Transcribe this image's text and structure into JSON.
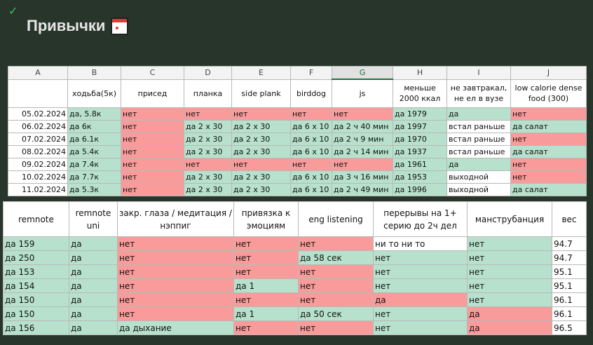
{
  "header": {
    "title": "Привычки",
    "icon": "calendar-icon",
    "status_icon": "check-icon"
  },
  "colors": {
    "g": "#b7e1cd",
    "r": "#f99b9b",
    "w": "#ffffff"
  },
  "sheet1": {
    "column_letters": [
      "A",
      "B",
      "C",
      "D",
      "E",
      "F",
      "G",
      "H",
      "I",
      "J"
    ],
    "selected_column": "G",
    "headers": [
      "",
      "ходьба(5к)",
      "присед",
      "планка",
      "side plank",
      "birddog",
      "js",
      "меньше 2000 ккал",
      "не завтракал, не ел в вузе",
      "low calorie dense food (300)"
    ],
    "rows": [
      {
        "date": "05.02.2024",
        "cells": [
          "да, 5.8к",
          "нет",
          "нет",
          "нет",
          "нет",
          "нет",
          "да 1979",
          "да",
          "нет"
        ],
        "colors": [
          "g",
          "r",
          "r",
          "r",
          "r",
          "r",
          "g",
          "g",
          "r"
        ]
      },
      {
        "date": "06.02.2024",
        "cells": [
          "да 6к",
          "нет",
          "да 2 x 30",
          "да 2 x 30",
          "да 6 x 10",
          "да 2 ч 40 мин",
          "да 1997",
          "встал раньше",
          "да салат"
        ],
        "colors": [
          "g",
          "r",
          "g",
          "g",
          "g",
          "g",
          "g",
          "w",
          "g"
        ]
      },
      {
        "date": "07.02.2024",
        "cells": [
          "да 6.1к",
          "нет",
          "да 2 x 30",
          "да 2 x 30",
          "да 6 x 10",
          "да 2 ч 9 мин",
          "да 1970",
          "встал раньше",
          "нет"
        ],
        "colors": [
          "g",
          "r",
          "g",
          "g",
          "g",
          "g",
          "g",
          "w",
          "r"
        ]
      },
      {
        "date": "08.02.2024",
        "cells": [
          "да 5.4к",
          "нет",
          "да 2 x 30",
          "да 2 x 30",
          "да 6 x 10",
          "да 2 ч 14 мин",
          "да 1937",
          "встал раньше",
          "да салат"
        ],
        "colors": [
          "g",
          "r",
          "g",
          "g",
          "g",
          "g",
          "g",
          "w",
          "g"
        ]
      },
      {
        "date": "09.02.2024",
        "cells": [
          "да 7.4к",
          "нет",
          "нет",
          "нет",
          "нет",
          "нет",
          "да 1961",
          "да",
          "нет"
        ],
        "colors": [
          "g",
          "r",
          "r",
          "r",
          "r",
          "r",
          "g",
          "g",
          "r"
        ]
      },
      {
        "date": "10.02.2024",
        "cells": [
          "да 7.7к",
          "нет",
          "да 2 x 30",
          "да 2 x 30",
          "да 6 x 10",
          "да 3 ч 16 мин",
          "да 1953",
          "выходной",
          "нет"
        ],
        "colors": [
          "g",
          "r",
          "g",
          "g",
          "g",
          "g",
          "g",
          "w",
          "r"
        ]
      },
      {
        "date": "11.02.2024",
        "cells": [
          "да 5.3к",
          "нет",
          "да 2 x 30",
          "да 2 x 30",
          "да 6 x 10",
          "да 2 ч 49 мин",
          "да 1996",
          "выходной",
          "да салат"
        ],
        "colors": [
          "g",
          "r",
          "g",
          "g",
          "g",
          "g",
          "g",
          "w",
          "g"
        ]
      }
    ]
  },
  "sheet2": {
    "headers": [
      "remnote",
      "remnote uni",
      "закр. глаза / медитация / нэппиг",
      "привязка к эмоциям",
      "eng listening",
      "перерывы на 1+ серию до 2ч дел",
      "манструбанция",
      "вес"
    ],
    "rows": [
      {
        "cells": [
          "да 159",
          "да",
          "нет",
          "нет",
          "нет",
          "ни то ни то",
          "нет",
          "94.7"
        ],
        "colors": [
          "g",
          "g",
          "r",
          "r",
          "r",
          "w",
          "g",
          "w"
        ]
      },
      {
        "cells": [
          "да 250",
          "да",
          "нет",
          "нет",
          "да 58 сек",
          "нет",
          "нет",
          "94.7"
        ],
        "colors": [
          "g",
          "g",
          "r",
          "r",
          "g",
          "g",
          "g",
          "w"
        ]
      },
      {
        "cells": [
          "да 153",
          "да",
          "нет",
          "нет",
          "нет",
          "нет",
          "нет",
          "95.1"
        ],
        "colors": [
          "g",
          "g",
          "r",
          "r",
          "r",
          "g",
          "g",
          "w"
        ]
      },
      {
        "cells": [
          "да 154",
          "да",
          "нет",
          "да 1",
          "нет",
          "нет",
          "нет",
          "95.1"
        ],
        "colors": [
          "g",
          "g",
          "r",
          "g",
          "r",
          "g",
          "g",
          "w"
        ]
      },
      {
        "cells": [
          "да 150",
          "да",
          "нет",
          "нет",
          "нет",
          "да",
          "нет",
          "96.1"
        ],
        "colors": [
          "g",
          "g",
          "r",
          "r",
          "r",
          "r",
          "g",
          "w"
        ]
      },
      {
        "cells": [
          "да 150",
          "да",
          "нет",
          "да 1",
          "да 50 сек",
          "нет",
          "да",
          "96.1"
        ],
        "colors": [
          "g",
          "g",
          "r",
          "g",
          "g",
          "g",
          "r",
          "w"
        ]
      },
      {
        "cells": [
          "да 156",
          "да",
          "да дыхание",
          "нет",
          "нет",
          "нет",
          "да",
          "96.5"
        ],
        "colors": [
          "g",
          "g",
          "g",
          "r",
          "r",
          "g",
          "r",
          "w"
        ]
      }
    ]
  }
}
